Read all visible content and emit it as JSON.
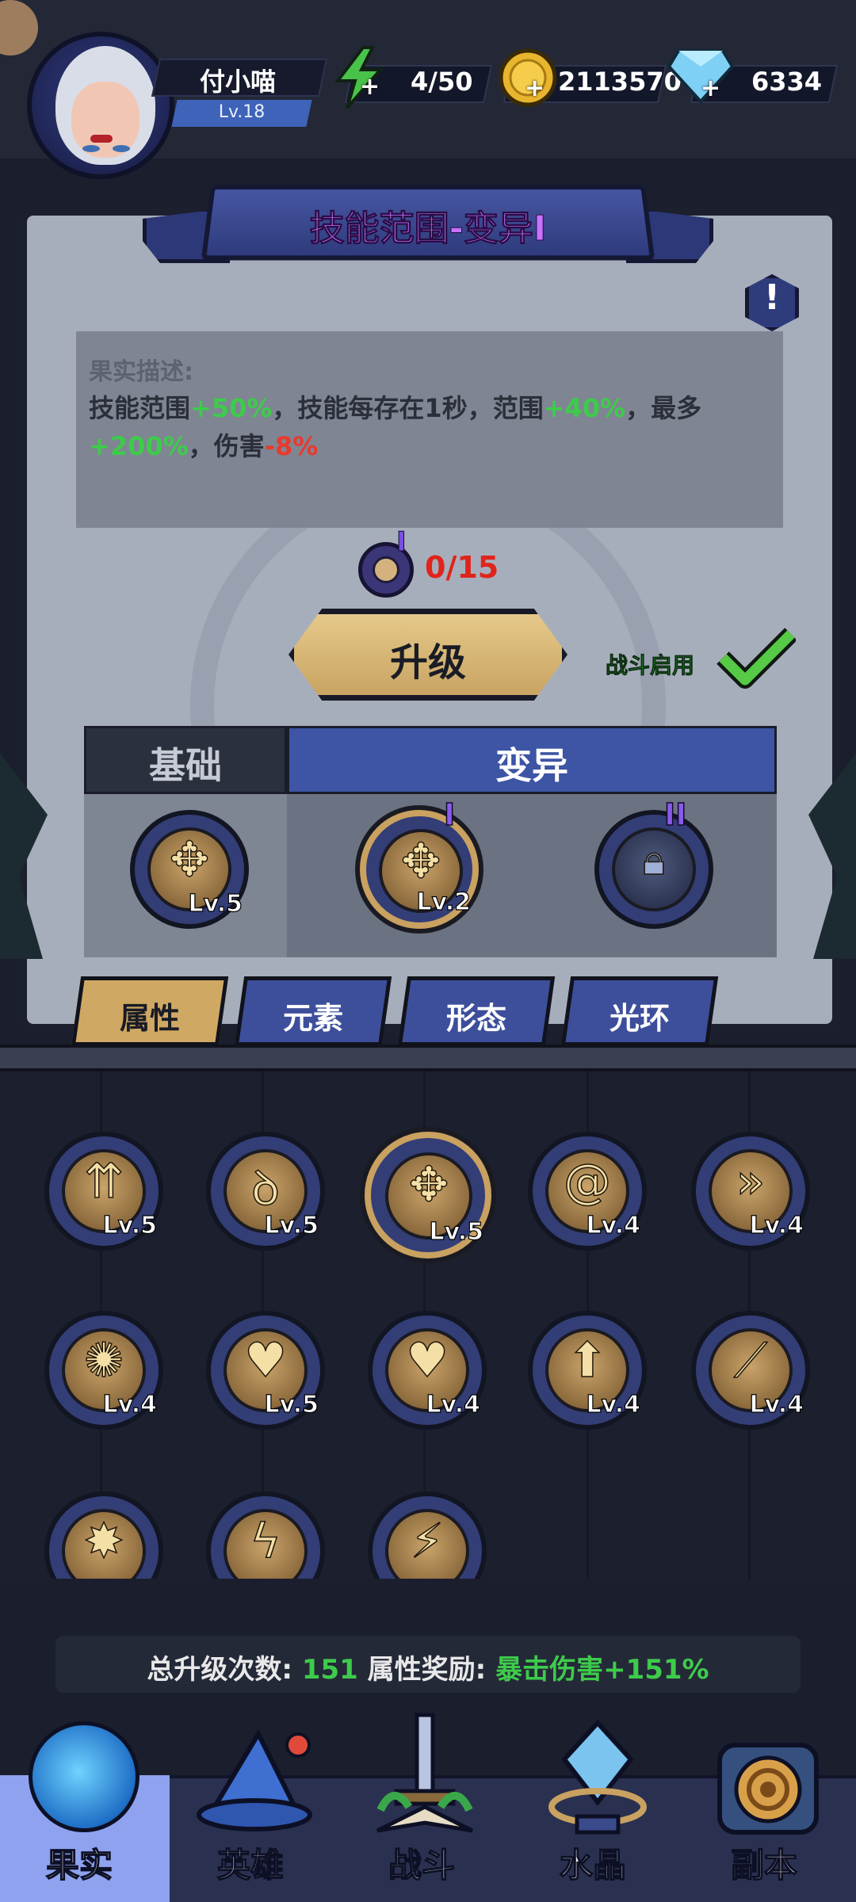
{
  "player": {
    "name": "付小喵",
    "level": "Lv.18"
  },
  "resources": {
    "energy": "4/50",
    "gold": "2113570",
    "diamonds": "6334"
  },
  "skill": {
    "title": "技能范围-变异I",
    "desc_label": "果实描述:",
    "desc_1": "技能范围",
    "desc_2": "+50%",
    "desc_3": "，技能每存在1秒，范围",
    "desc_4": "+40%",
    "desc_5": "，最多",
    "desc_6": "+200%",
    "desc_7": "，伤害",
    "desc_8": "-8%",
    "cost_roman": "I",
    "cost": "0/15",
    "upgrade_label": "升级",
    "battle_toggle_label": "战斗启用",
    "battle_enabled": true
  },
  "branch_tabs": {
    "base": "基础",
    "mutation": "变异"
  },
  "branch_nodes": [
    {
      "level": "Lv.5",
      "icon": "burst-icon"
    },
    {
      "level": "Lv.2",
      "icon": "burst-icon",
      "roman": "I",
      "selected": true
    },
    {
      "level": "",
      "icon": "lock-icon",
      "roman": "II",
      "locked": true
    }
  ],
  "category_tabs": [
    "属性",
    "元素",
    "形态",
    "光环"
  ],
  "active_category": "属性",
  "grid": [
    {
      "level": "Lv.5",
      "icon": "arrows-up-icon"
    },
    {
      "level": "Lv.5",
      "icon": "spiral-square-icon"
    },
    {
      "level": "Lv.5",
      "icon": "burst-icon",
      "selected": true
    },
    {
      "level": "Lv.4",
      "icon": "swirl-icon"
    },
    {
      "level": "Lv.4",
      "icon": "chevrons-right-icon"
    },
    {
      "level": "Lv.4",
      "icon": "impact-icon"
    },
    {
      "level": "Lv.5",
      "icon": "broken-heart-icon"
    },
    {
      "level": "Lv.4",
      "icon": "heart-sparkle-icon"
    },
    {
      "level": "Lv.4",
      "icon": "power-up-icon"
    },
    {
      "level": "Lv.4",
      "icon": "spread-icon"
    },
    {
      "level": "",
      "icon": "explosion-icon"
    },
    {
      "level": "",
      "icon": "lightning-icon"
    },
    {
      "level": "",
      "icon": "bolt-icon"
    }
  ],
  "stats": {
    "total_label": "总升级次数:",
    "total_value": "151",
    "bonus_label": "属性奖励:",
    "bonus_value": "暴击伤害+151%"
  },
  "bottom_nav": [
    {
      "label": "果实",
      "active": true
    },
    {
      "label": "英雄"
    },
    {
      "label": "战斗"
    },
    {
      "label": "水晶"
    },
    {
      "label": "副本"
    }
  ],
  "colors": {
    "accent_gold": "#c9a160",
    "mutation_blue": "#3d55a4",
    "positive": "#3ecb4b",
    "negative": "#e83a2e",
    "title_purple": "#c773ff"
  }
}
